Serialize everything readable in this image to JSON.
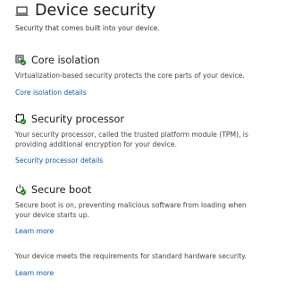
{
  "header": {
    "icon": "laptop-icon",
    "title": "Device security",
    "subtitle": "Security that comes built into your device."
  },
  "sections": [
    {
      "icon": "core-isolation-icon",
      "title": "Core isolation",
      "description": "Virtualization-based security protects the core parts of your device.",
      "link": "Core isolation details"
    },
    {
      "icon": "chip-icon",
      "title": "Security processor",
      "description": "Your security processor, called the trusted platform module (TPM), is providing additional encryption for your device.",
      "link": "Security processor details"
    },
    {
      "icon": "power-check-icon",
      "title": "Secure boot",
      "description": "Secure boot is on, preventing malicious software from loading when your device starts up.",
      "link": "Learn more"
    }
  ],
  "footer": {
    "description": "Your device meets the requirements for standard hardware security.",
    "link": "Learn more"
  },
  "colors": {
    "link": "#0a58b8",
    "status_ok": "#107c10"
  }
}
